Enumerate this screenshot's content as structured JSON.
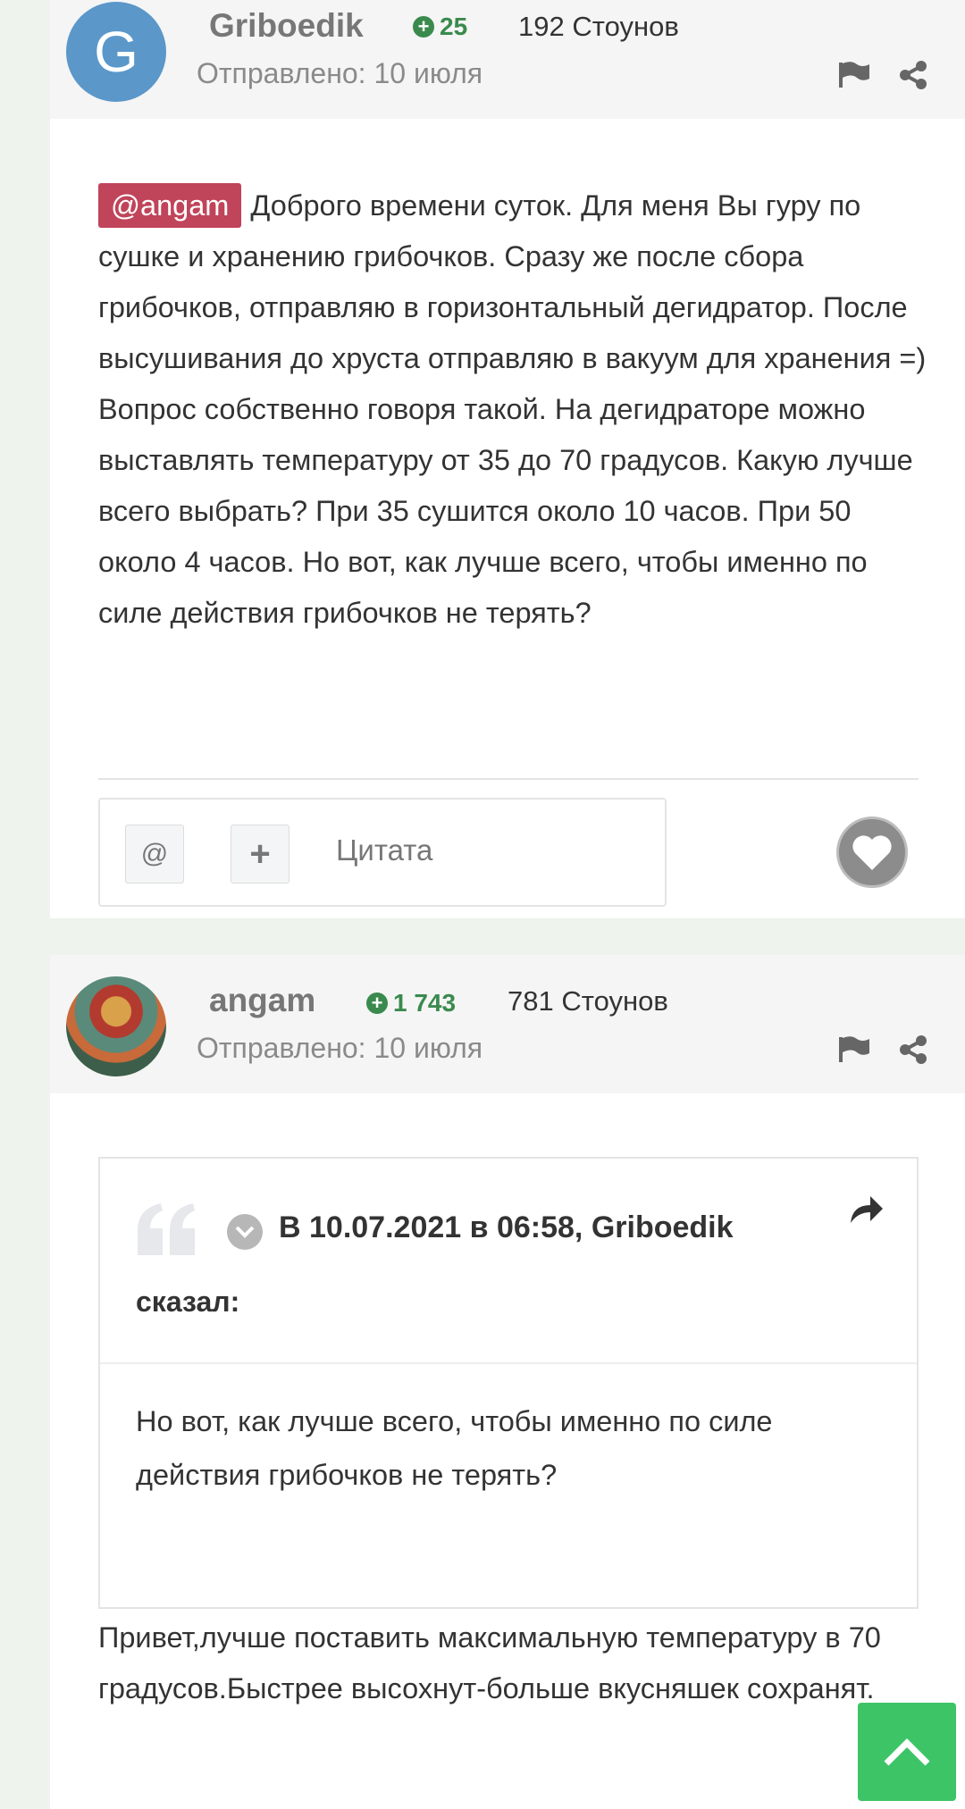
{
  "post1": {
    "avatar_letter": "G",
    "author": "Griboedik",
    "reputation": "25",
    "stones": "192 Стоунов",
    "sent": "Отправлено: 10 июля",
    "mention": "@angam",
    "body": "Доброго времени суток. Для меня Вы гуру по сушке и хранению грибочков. Сразу же после сбора грибочков, отправляю в горизонтальный дегидратор. После высушивания до хруста отправляю в вакуум для хранения =) Вопрос собственно говоря такой. На дегидраторе можно выставлять температуру от 35 до 70 градусов. Какую лучше всего выбрать? При 35 сушится около 10 часов. При 50 около 4 часов. Но вот, как лучше всего, чтобы именно по силе действия грибочков не терять?",
    "toolbar": {
      "mention_btn": "@",
      "add_btn": "+",
      "quote_label": "Цитата"
    }
  },
  "post2": {
    "author": "angam",
    "reputation": "1 743",
    "stones": "781 Стоунов",
    "sent": "Отправлено: 10 июля",
    "quote": {
      "header_prefix": "В 10.07.2021 в 06:58,",
      "header_author": "Griboedik",
      "said": "сказал:",
      "text": "Но вот, как лучше всего, чтобы именно по силе действия грибочков не терять?"
    },
    "reply": "Привет,лучше поставить максимальную температуру в 70 градусов.Быстрее высохнут-больше вкусняшек сохранят."
  },
  "colors": {
    "accent_green": "#3dc467",
    "mention_red": "#c0445a",
    "rep_green": "#3a8a4e",
    "avatar_blue": "#5b97c9"
  },
  "icons": [
    "flag-icon",
    "share-icon",
    "heart-icon",
    "quote-mark-icon",
    "chevron-down-icon",
    "forward-icon",
    "arrow-up-icon"
  ]
}
